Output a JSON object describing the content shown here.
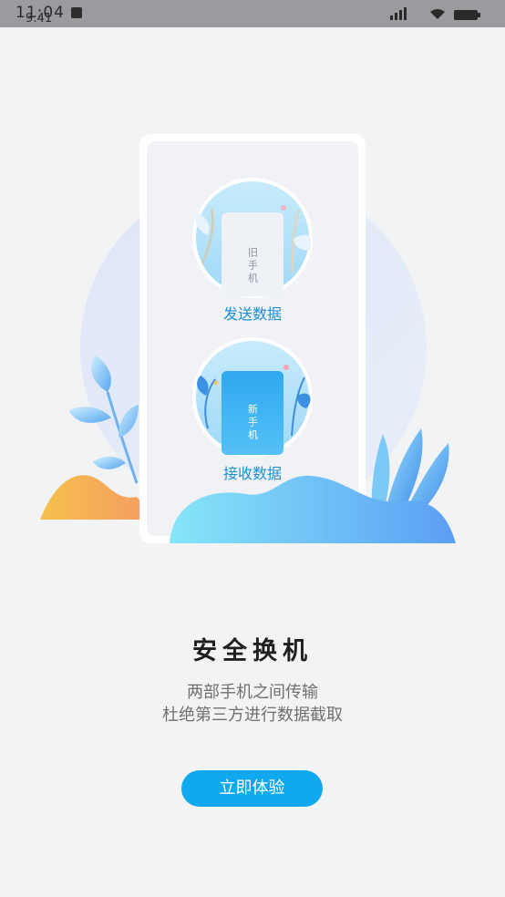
{
  "status_bar": {
    "time": "11:04",
    "time_overlay": "9:41"
  },
  "illustration": {
    "old_phone_label": "旧手机",
    "send_data_label": "发送数据",
    "new_phone_label": "新手机",
    "receive_data_label": "接收数据"
  },
  "main": {
    "title": "安全换机",
    "subtitle_line1": "两部手机之间传输",
    "subtitle_line2": "杜绝第三方进行数据截取",
    "cta_label": "立即体验"
  },
  "colors": {
    "accent": "#10a9ef",
    "label_blue": "#1a8fd6",
    "background": "#f2f3f5"
  }
}
